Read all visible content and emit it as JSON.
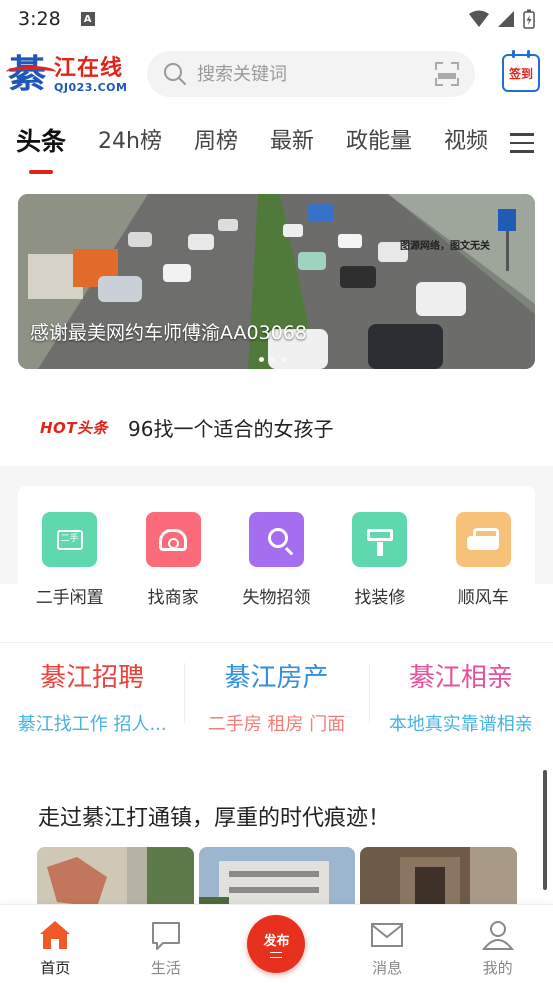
{
  "status_bar": {
    "time": "3:28",
    "notification_badge": "A"
  },
  "header": {
    "logo_main": "綦",
    "logo_text": "江在线",
    "logo_domain": "QJ023.COM",
    "search_placeholder": "搜索关键词",
    "checkin_label": "签到"
  },
  "tabs": [
    "头条",
    "24h榜",
    "周榜",
    "最新",
    "政能量",
    "视频"
  ],
  "banner": {
    "caption": "感谢最美网约车师傅渝AA03068",
    "watermark": "图源网络，图文无关",
    "dots": 3,
    "active_dot": 0
  },
  "hot": {
    "badge": "HOT头条",
    "text": "96找一个适合的女孩子"
  },
  "services": [
    {
      "label": "二手闲置",
      "color": "#5fd8ad",
      "icon": "tag-icon"
    },
    {
      "label": "找商家",
      "color": "#fb6b7a",
      "icon": "phone-icon"
    },
    {
      "label": "失物招领",
      "color": "#a56ef0",
      "icon": "search-icon"
    },
    {
      "label": "找装修",
      "color": "#5fd8ad",
      "icon": "brush-icon"
    },
    {
      "label": "顺风车",
      "color": "#f6c27a",
      "icon": "car-icon"
    }
  ],
  "channels": [
    {
      "title": "綦江招聘",
      "sub": "綦江找工作 招人...",
      "title_color": "#e9433c",
      "sub_color": "#47b3e0"
    },
    {
      "title": "綦江房产",
      "sub": "二手房 租房 门面",
      "title_color": "#2f8fe3",
      "sub_color": "#f27d79"
    },
    {
      "title": "綦江相亲",
      "sub": "本地真实靠谱相亲",
      "title_color": "#e84f9e",
      "sub_color": "#47b3e0"
    }
  ],
  "article": {
    "title": "走过綦江打通镇，厚重的时代痕迹！"
  },
  "bottom_nav": [
    {
      "label": "首页",
      "icon": "home-icon",
      "active": true
    },
    {
      "label": "生活",
      "icon": "chat-icon",
      "active": false
    },
    {
      "label": "发布",
      "icon": "publish-icon",
      "active": false
    },
    {
      "label": "消息",
      "icon": "mail-icon",
      "active": false
    },
    {
      "label": "我的",
      "icon": "user-icon",
      "active": false
    }
  ],
  "colors": {
    "accent": "#e2231a",
    "brand_blue": "#1f57b8"
  }
}
